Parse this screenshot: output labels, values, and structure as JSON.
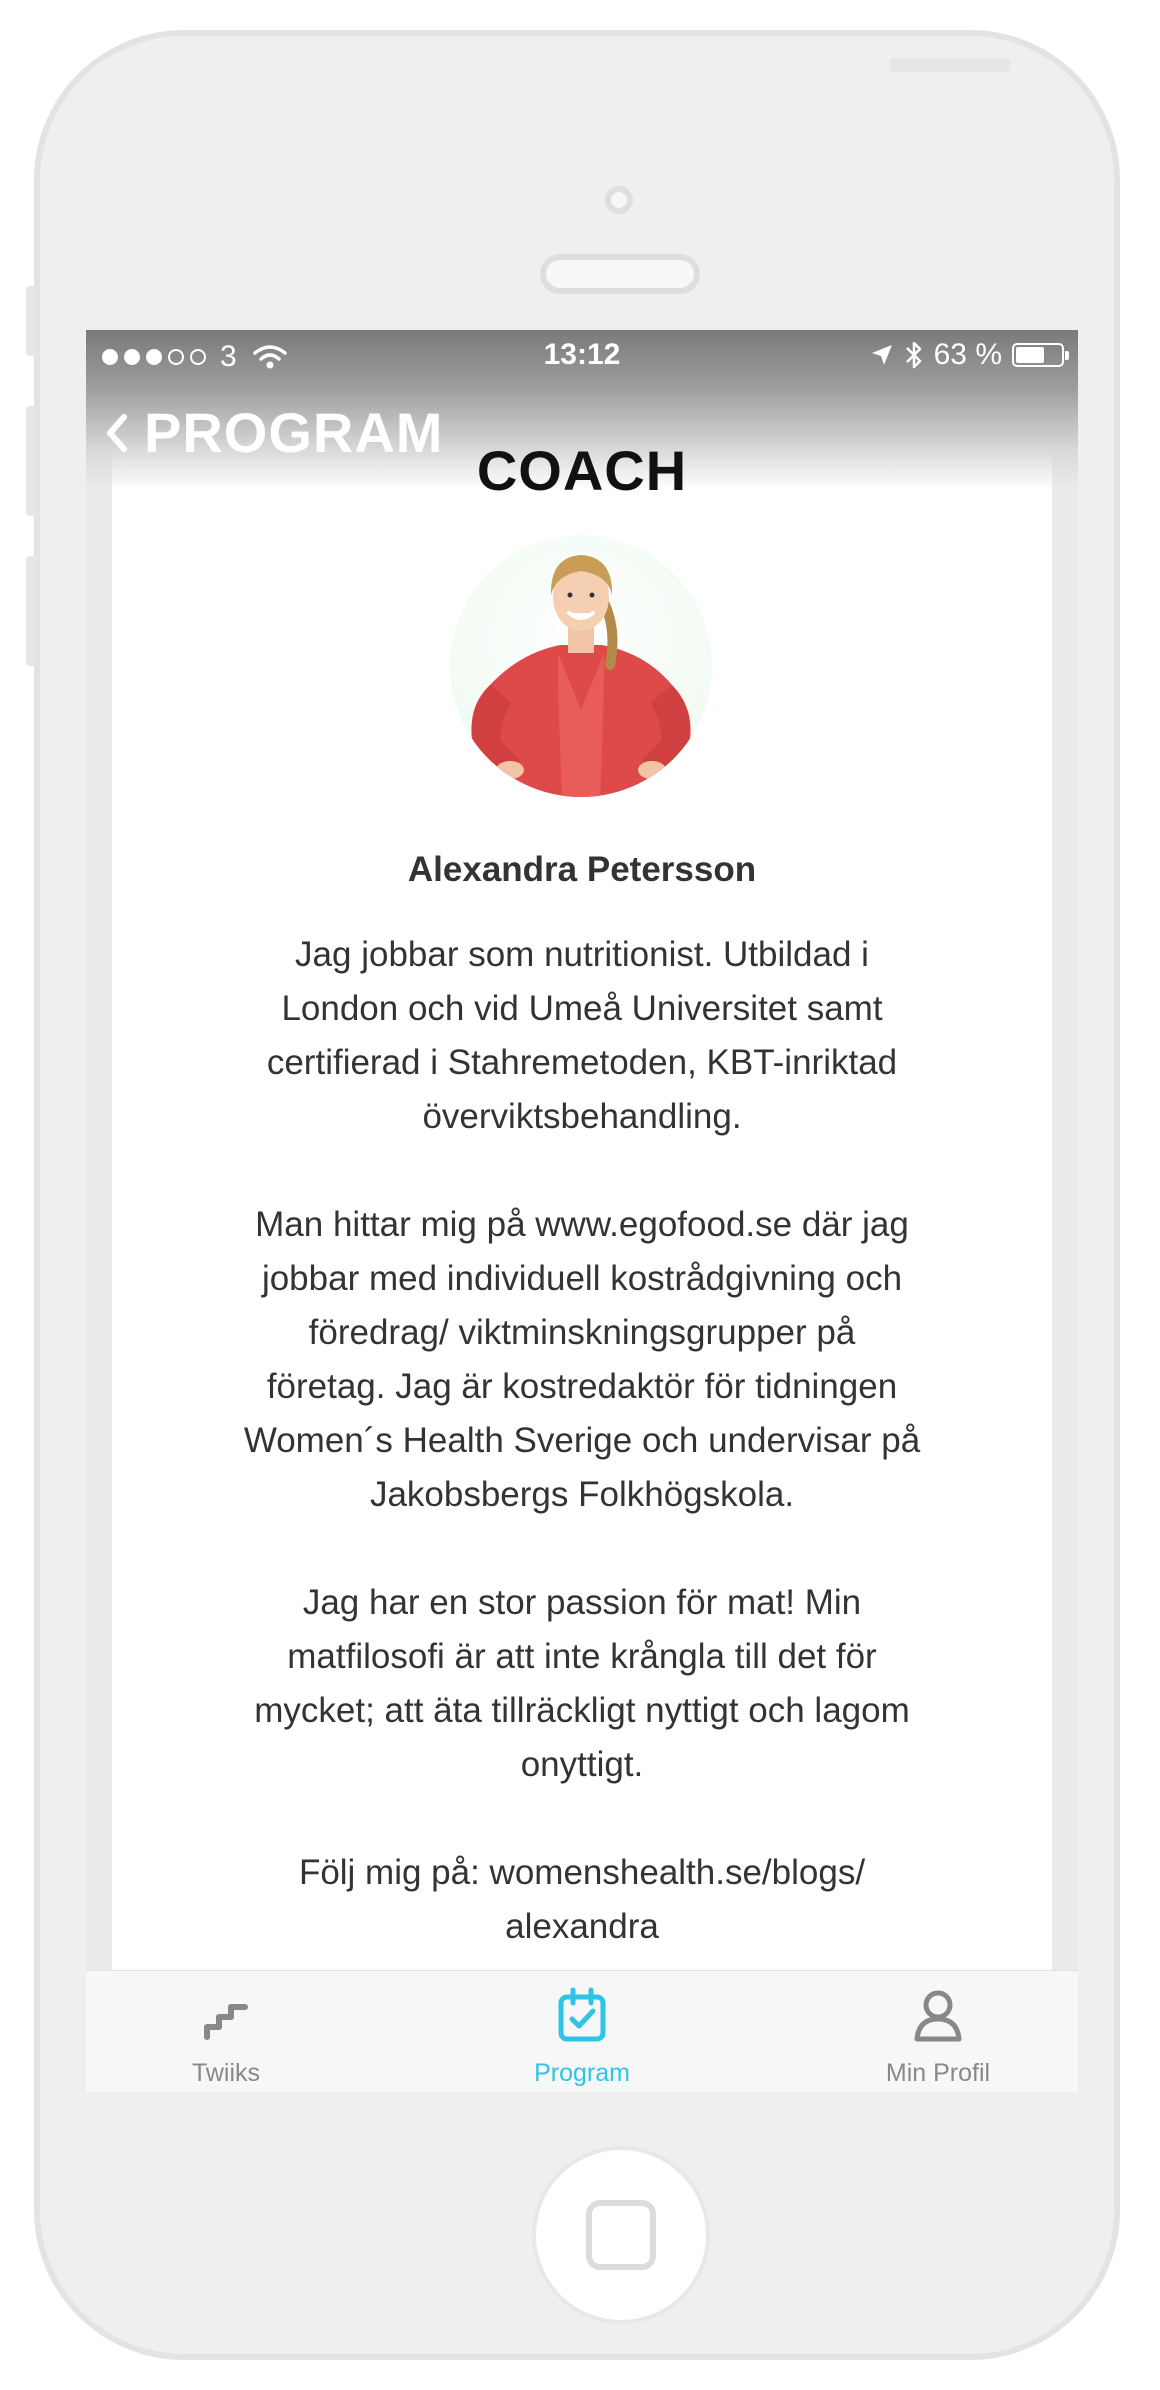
{
  "status_bar": {
    "carrier": "3",
    "time": "13:12",
    "battery_percent": "63 %",
    "battery_level": 0.63
  },
  "nav": {
    "back_label": "PROGRAM",
    "title": "COACH"
  },
  "coach": {
    "name": "Alexandra Petersson",
    "bio": [
      "Jag jobbar som nutritionist. Utbildad i\nLondon och vid Umeå Universitet samt\ncertifierad i Stahremetoden, KBT-inriktad\növerviktsbehandling.",
      "Man hittar mig på www.egofood.se där jag\njobbar med individuell kostrådgivning och\nföredrag/ viktminskningsgrupper på\nföretag. Jag är kostredaktör för tidningen\nWomen´s Health Sverige och undervisar på\nJakobsbergs Folkhögskola.",
      "Jag har en stor passion för mat! Min\nmatfilosofi är att inte krångla till det för\nmycket; att äta tillräckligt nyttigt och lagom\nonyttigt.",
      "Följ mig på: womenshealth.se/blogs/\nalexandra"
    ]
  },
  "tabs": [
    {
      "label": "Twiiks",
      "icon": "stairs-icon",
      "active": false
    },
    {
      "label": "Program",
      "icon": "calendar-check-icon",
      "active": true
    },
    {
      "label": "Min Profil",
      "icon": "person-icon",
      "active": false
    }
  ],
  "colors": {
    "accent": "#2ec4e6",
    "inactive_tab": "#888888",
    "text": "#333333"
  }
}
